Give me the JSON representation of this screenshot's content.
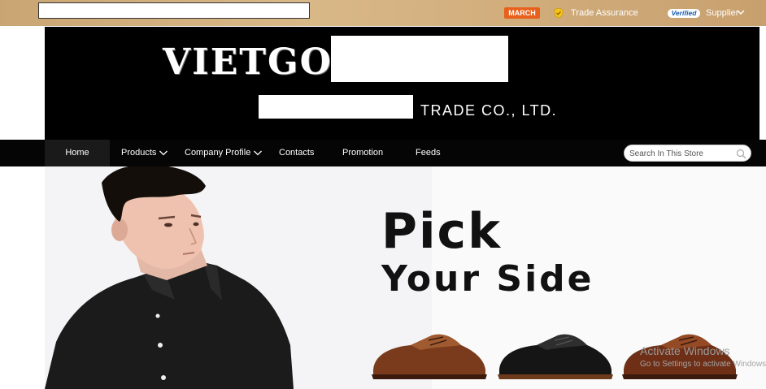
{
  "topbar": {
    "march_badge": "MARCH",
    "trade_assurance": "Trade Assurance",
    "verified": "Verified",
    "supplier": "Supplier"
  },
  "banner": {
    "logo": "VIETGO",
    "company_suffix": "TRADE CO., LTD."
  },
  "nav": {
    "items": [
      "Home",
      "Products",
      "Company Profile",
      "Contacts",
      "Promotion",
      "Feeds"
    ],
    "search_placeholder": "Search In This Store"
  },
  "hero": {
    "headline_line1": "Pick",
    "headline_line2": "Your Side"
  },
  "watermark": {
    "line1": "Activate Windows",
    "line2": "Go to Settings to activate Windows."
  },
  "colors": {
    "topbar": "#caa574",
    "banner": "#000000",
    "nav": "#050505",
    "march_badge": "#e8601c"
  }
}
